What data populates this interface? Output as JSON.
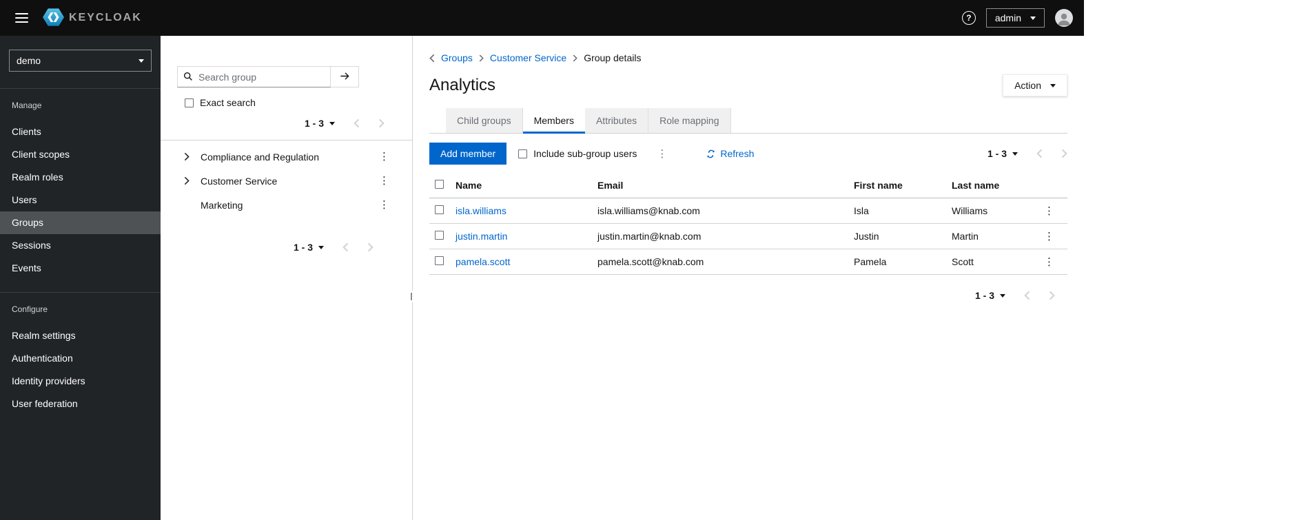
{
  "colors": {
    "accent": "#0066cc",
    "masthead_bg": "#0f0f0f",
    "sidebar_bg": "#212427",
    "sidebar_active_bg": "#4f5255",
    "border": "#d2d2d2",
    "muted_text": "#6a6e73"
  },
  "icons": {
    "kebab": "⋮",
    "help": "?"
  },
  "topbar": {
    "brand": "KEYCLOAK",
    "user_menu_label": "admin"
  },
  "sidebar": {
    "realm": "demo",
    "sections": [
      {
        "label": "Manage",
        "items": [
          {
            "label": "Clients"
          },
          {
            "label": "Client scopes"
          },
          {
            "label": "Realm roles"
          },
          {
            "label": "Users"
          },
          {
            "label": "Groups"
          },
          {
            "label": "Sessions"
          },
          {
            "label": "Events"
          }
        ]
      },
      {
        "label": "Configure",
        "items": [
          {
            "label": "Realm settings"
          },
          {
            "label": "Authentication"
          },
          {
            "label": "Identity providers"
          },
          {
            "label": "User federation"
          }
        ]
      }
    ]
  },
  "groups_panel": {
    "search_placeholder": "Search group",
    "exact_search_label": "Exact search",
    "pagination_top": "1 - 3",
    "pagination_bottom": "1 - 3",
    "tree": [
      {
        "label": "Compliance and Regulation"
      },
      {
        "label": "Customer Service"
      },
      {
        "label": "Marketing"
      }
    ]
  },
  "main": {
    "breadcrumb": {
      "link1": "Groups",
      "link2": "Customer Service",
      "current": "Group details"
    },
    "page_title": "Analytics",
    "action_label": "Action",
    "tabs": {
      "child_groups": "Child groups",
      "members": "Members",
      "attributes": "Attributes",
      "role_mapping": "Role mapping"
    },
    "toolbar": {
      "add_member": "Add member",
      "include_subgroups": "Include sub-group users",
      "refresh": "Refresh",
      "pagination": "1 - 3"
    },
    "table": {
      "headers": {
        "name": "Name",
        "email": "Email",
        "first_name": "First name",
        "last_name": "Last name"
      },
      "rows": [
        {
          "name": "isla.williams",
          "email": "isla.williams@knab.com",
          "first_name": "Isla",
          "last_name": "Williams"
        },
        {
          "name": "justin.martin",
          "email": "justin.martin@knab.com",
          "first_name": "Justin",
          "last_name": "Martin"
        },
        {
          "name": "pamela.scott",
          "email": "pamela.scott@knab.com",
          "first_name": "Pamela",
          "last_name": "Scott"
        }
      ]
    },
    "pagination_bottom": "1 - 3"
  }
}
